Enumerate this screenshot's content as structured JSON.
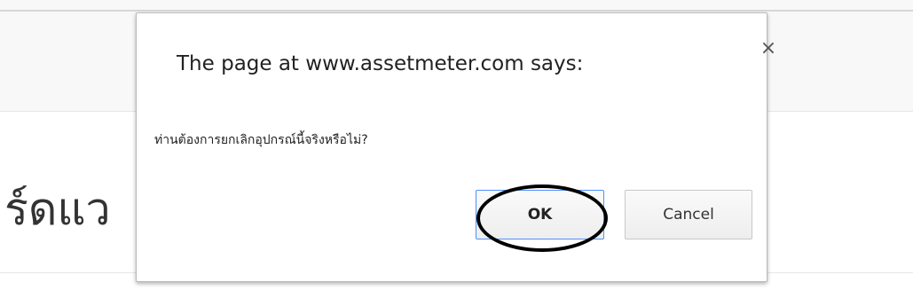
{
  "page": {
    "heading": "ร์ดแว"
  },
  "dialog": {
    "title": "The page at www.assetmeter.com says:",
    "message": "ท่านต้องการยกเลิกอุปกรณ์นี้จริงหรือไม่?",
    "close_glyph": "×",
    "ok_label": "OK",
    "cancel_label": "Cancel"
  },
  "colors": {
    "focus_border": "#4d90fe",
    "highlight_circle": "#000000"
  }
}
